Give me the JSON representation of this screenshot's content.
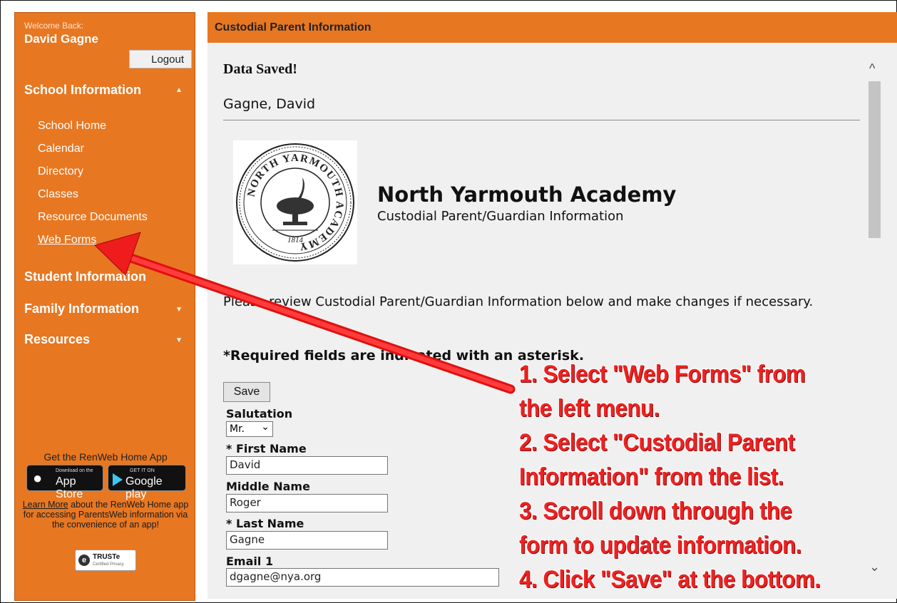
{
  "sidebar": {
    "welcome_label": "Welcome Back:",
    "user_name": "David Gagne",
    "logout_label": "Logout",
    "sections": {
      "school": "School Information",
      "student": "Student Information",
      "family": "Family Information",
      "resources": "Resources"
    },
    "school_items": [
      "School Home",
      "Calendar",
      "Directory",
      "Classes",
      "Resource Documents",
      "Web Forms"
    ],
    "app": {
      "title": "Get the RenWeb Home App",
      "apple_small": "Download on the",
      "apple_big": "App Store",
      "google_small": "GET IT ON",
      "google_big": "Google play",
      "learn_more": "Learn More",
      "description": " about the RenWeb Home app for accessing ParentsWeb information via the convenience of an app!"
    },
    "truste": {
      "title": "TRUSTe",
      "subtitle": "Certified Privacy"
    }
  },
  "header": {
    "title": "Custodial Parent Information"
  },
  "main": {
    "status": "Data Saved!",
    "person": "Gagne, David",
    "school_name": "North Yarmouth Academy",
    "form_subtitle": "Custodial Parent/Guardian Information",
    "seal": {
      "ring_text": "NORTH YARMOUTH ACADEMY",
      "year": "1814"
    },
    "instructions": "Please review Custodial Parent/Guardian Information below and make changes if necessary.",
    "required_note": "*Required fields are indicated with an asterisk.",
    "save_label": "Save",
    "fields": {
      "salutation_label": "Salutation",
      "salutation_value": "Mr.",
      "first_name_label": "* First Name",
      "first_name_value": "David",
      "middle_name_label": "Middle Name",
      "middle_name_value": "Roger",
      "last_name_label": "* Last Name",
      "last_name_value": "Gagne",
      "email_label": "Email 1",
      "email_value": "dgagne@nya.org"
    }
  },
  "annotation": {
    "lines": [
      "1.  Select \"Web Forms\" from",
      "the left menu.",
      "2.  Select \"Custodial Parent",
      "Information\" from the list.",
      "3.  Scroll down through the",
      "form to update information.",
      "4.  Click \"Save\" at the bottom."
    ],
    "color": "#ee2222"
  },
  "colors": {
    "brand_orange": "#e87722",
    "content_bg": "#f0f0f0"
  }
}
